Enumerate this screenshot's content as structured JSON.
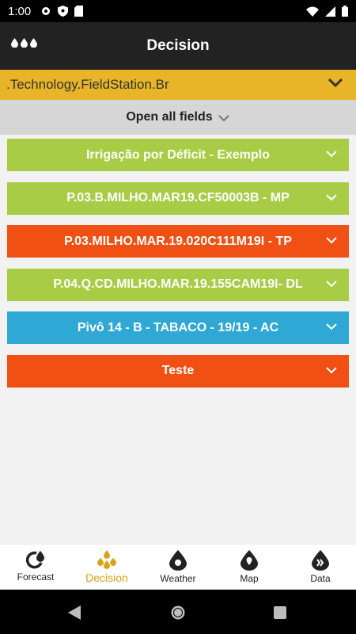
{
  "status_bar": {
    "time": "1:00"
  },
  "app_bar": {
    "title": "Decision",
    "menu_icon": "dots-menu-icon"
  },
  "station": {
    "name": ".Technology.FieldStation.Br"
  },
  "open_all": {
    "label": "Open all fields"
  },
  "fields": [
    {
      "label": "Irrigação por Déficit - Exemplo",
      "color": "#a8cc46"
    },
    {
      "label": "P.03.B.MILHO.MAR19.CF50003B - MP",
      "color": "#a8cc46"
    },
    {
      "label": "P.03.MILHO.MAR.19.020C111M19I - TP",
      "color": "#f05014"
    },
    {
      "label": "P.04.Q.CD.MILHO.MAR.19.155CAM19I- DL",
      "color": "#a8cc46"
    },
    {
      "label": "Pivô 14 - B - TABACO - 19/19 - AC",
      "color": "#2fa8d5"
    },
    {
      "label": "Teste",
      "color": "#f05014"
    }
  ],
  "bottom_nav": {
    "forecast": "Forecast",
    "decision": "Decision",
    "weather": "Weather",
    "map": "Map",
    "data": "Data"
  },
  "colors": {
    "accent": "#d9a21b",
    "station_bar": "#e8b528",
    "app_bar": "#222222"
  }
}
